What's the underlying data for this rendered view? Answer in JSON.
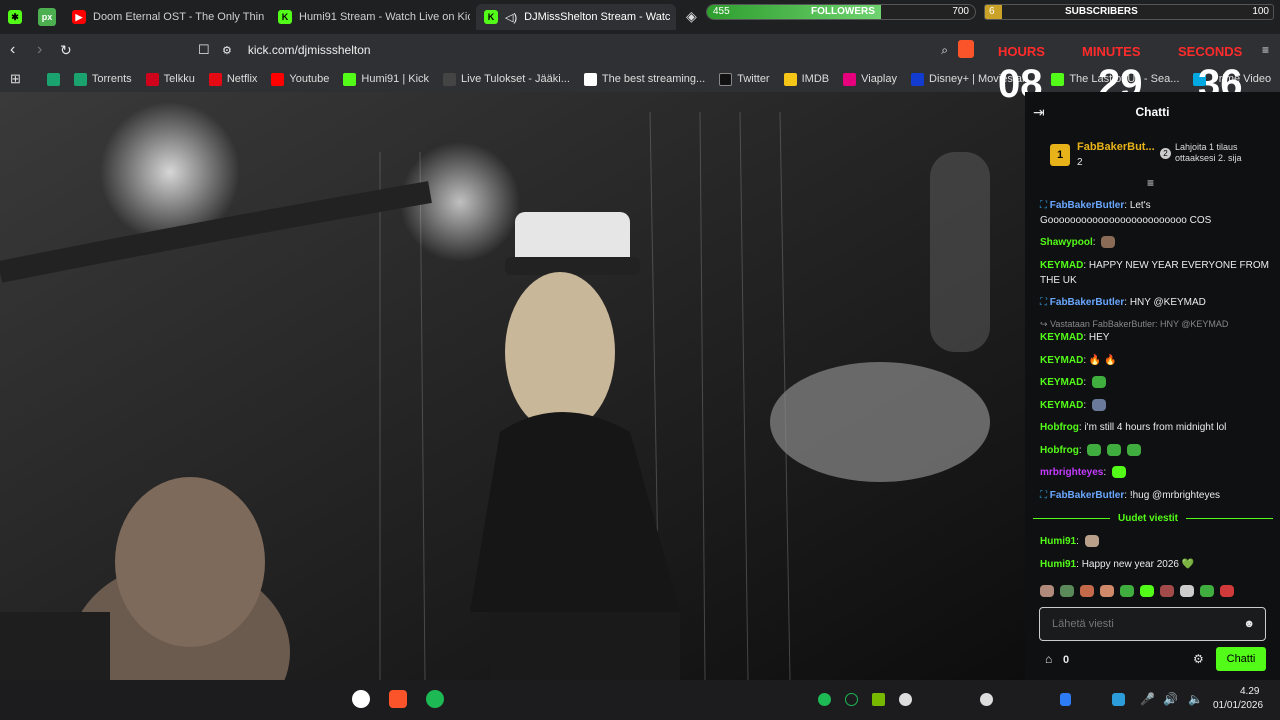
{
  "tabs": [
    {
      "title": "Doom Eternal OST - The Only Thing",
      "fav": "youtube-icon",
      "color": "#ff0000"
    },
    {
      "title": "Humi91 Stream - Watch Live on Kick",
      "fav": "kick-icon",
      "color": "#53fc18"
    },
    {
      "title": "DJMissShelton Stream - Watc",
      "fav": "kick-icon",
      "color": "#53fc18",
      "prefix": "◁)"
    }
  ],
  "address": {
    "url": "kick.com/djmissshelton",
    "shield_badge": "4"
  },
  "bookmarks": [
    {
      "label": "Torrents",
      "color": "#1aa36f"
    },
    {
      "label": "Telkku",
      "color": "#d0021b"
    },
    {
      "label": "Netflix",
      "color": "#e50914"
    },
    {
      "label": "Youtube",
      "color": "#ff0000"
    },
    {
      "label": "Humi91 | Kick",
      "color": "#53fc18"
    },
    {
      "label": "Live Tulokset - Jääki...",
      "color": "#222222"
    },
    {
      "label": "The best streaming...",
      "color": "#ffffff"
    },
    {
      "label": "Twitter",
      "color": "#000000"
    },
    {
      "label": "IMDB",
      "color": "#f5c518"
    },
    {
      "label": "Viaplay",
      "color": "#e6007e"
    },
    {
      "label": "Disney+ | Movies an...",
      "color": "#113ccf"
    },
    {
      "label": "The Last of Us - Sea...",
      "color": "#53fc18"
    },
    {
      "label": "Prime Video",
      "color": "#00a8e1"
    }
  ],
  "overlay": {
    "followers_label": "FOLLOWERS",
    "followers_value": "455",
    "followers_goal": "700",
    "followers_progress": 0.65,
    "subs_label": "SUBSCRIBERS",
    "subs_value": "6",
    "subs_goal": "100",
    "subs_progress": 0.06,
    "timer": {
      "hours_label": "HOURS",
      "minutes_label": "MINUTES",
      "seconds_label": "SECONDS",
      "hours": "08",
      "minutes": "29",
      "seconds": "36"
    }
  },
  "chat": {
    "title": "Chatti",
    "leader": {
      "rank": "1",
      "name": "FabBakerBut...",
      "count": "2",
      "gift_text_1": "Lahjoita 1 tilaus",
      "gift_text_2": "ottaaksesi 2. sija",
      "gift_badge": "2"
    },
    "messages": [
      {
        "user": "FabBakerButler",
        "text": "Let's Gooooooooooooooooooooooooo COS",
        "style": "u2",
        "badges": true
      },
      {
        "user": "Shawypool",
        "text": "",
        "style": "u",
        "emote": true
      },
      {
        "user": "KEYMAD",
        "text": "HAPPY NEW YEAR EVERYONE FROM THE UK",
        "style": "u"
      },
      {
        "user": "FabBakerButler",
        "text": "HNY @KEYMAD",
        "style": "u2",
        "badges": true
      },
      {
        "reply": "Vastataan FabBakerButler: HNY @KEYMAD"
      },
      {
        "user": "KEYMAD",
        "text": "HEY",
        "style": "u"
      },
      {
        "user": "KEYMAD",
        "text": "🔥 🔥",
        "style": "u"
      },
      {
        "user": "KEYMAD",
        "text": "",
        "style": "u",
        "emote": true
      },
      {
        "user": "KEYMAD",
        "text": "",
        "style": "u",
        "emote": true
      },
      {
        "user": "Hobfrog",
        "text": "i'm still 4 hours from midnight lol",
        "style": "u"
      },
      {
        "user": "Hobfrog",
        "text": "",
        "style": "u",
        "emote": true
      },
      {
        "user": "mrbrighteyes",
        "text": "",
        "style": "u3",
        "emote": true
      },
      {
        "user": "FabBakerButler",
        "text": "!hug @mrbrighteyes",
        "style": "u2",
        "badges": true
      }
    ],
    "new_messages_label": "Uudet viestit",
    "new_messages": [
      {
        "user": "Humi91",
        "text": "",
        "emote": true
      },
      {
        "user": "Humi91",
        "text": "Happy new year 2026 💚"
      }
    ],
    "input_placeholder": "Lähetä viesti",
    "points": "0",
    "send_label": "Chatti"
  },
  "taskbar": {
    "time": "4.29",
    "date": "01/01/2026"
  }
}
